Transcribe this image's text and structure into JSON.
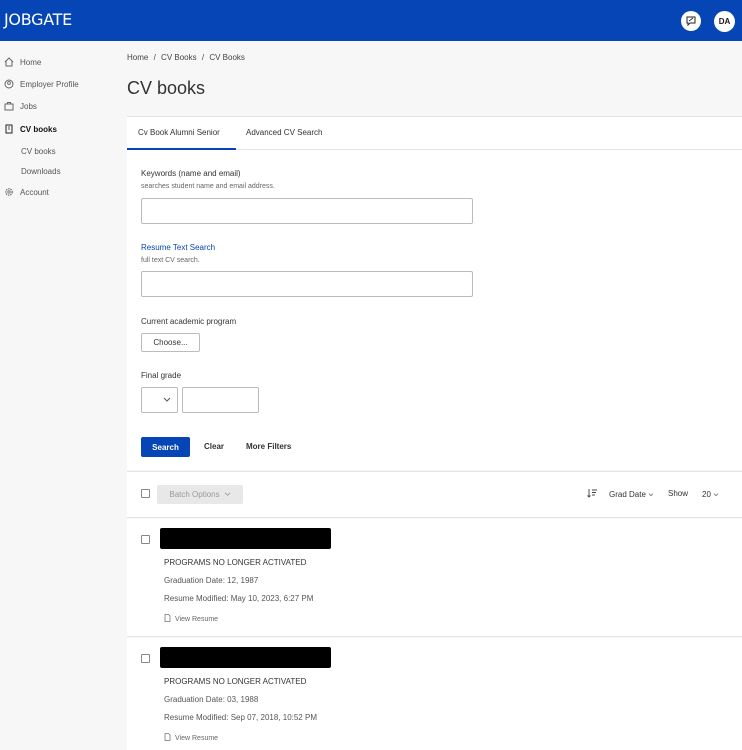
{
  "header": {
    "logo": "JOBGATE",
    "avatar_initials": "DA",
    "message_icon": "message-icon"
  },
  "sidebar": {
    "items": [
      {
        "label": "Home",
        "icon": "home-icon"
      },
      {
        "label": "Employer Profile",
        "icon": "user-circle-icon"
      },
      {
        "label": "Jobs",
        "icon": "briefcase-icon"
      },
      {
        "label": "CV books",
        "icon": "book-icon",
        "active": true
      },
      {
        "label": "Account",
        "icon": "gear-icon"
      }
    ],
    "sub_items": [
      {
        "label": "CV books"
      },
      {
        "label": "Downloads"
      }
    ]
  },
  "breadcrumb": {
    "items": [
      "Home",
      "CV Books",
      "CV Books"
    ],
    "separator": "/"
  },
  "page": {
    "title": "CV books"
  },
  "tabs": [
    {
      "label": "Cv Book Alumni Senior",
      "active": true
    },
    {
      "label": "Advanced CV Search"
    }
  ],
  "form": {
    "keywords": {
      "label": "Keywords (name and email)",
      "hint": "searches student name and email address.",
      "value": ""
    },
    "resume_text": {
      "label": "Resume Text Search",
      "hint": "full text CV search.",
      "value": ""
    },
    "program": {
      "label": "Current academic program",
      "button": "Choose..."
    },
    "grade": {
      "label": "Final grade",
      "operator": "",
      "value": ""
    },
    "actions": {
      "search": "Search",
      "clear": "Clear",
      "more": "More Filters"
    }
  },
  "list_toolbar": {
    "batch": "Batch Options",
    "sort_label": "Grad Date",
    "show_label": "Show",
    "show_value": "20"
  },
  "results": [
    {
      "program": "PROGRAMS NO LONGER ACTIVATED",
      "graduation": "Graduation Date: 12, 1987",
      "modified": "Resume Modified: May 10, 2023, 6:27 PM",
      "view": "View Resume"
    },
    {
      "program": "PROGRAMS NO LONGER ACTIVATED",
      "graduation": "Graduation Date: 03, 1988",
      "modified": "Resume Modified: Sep 07, 2018, 10:52 PM",
      "view": "View Resume"
    }
  ],
  "colors": {
    "brand": "#0645b5",
    "background": "#f7f7f7",
    "card": "#ffffff",
    "redaction": "#000000"
  }
}
